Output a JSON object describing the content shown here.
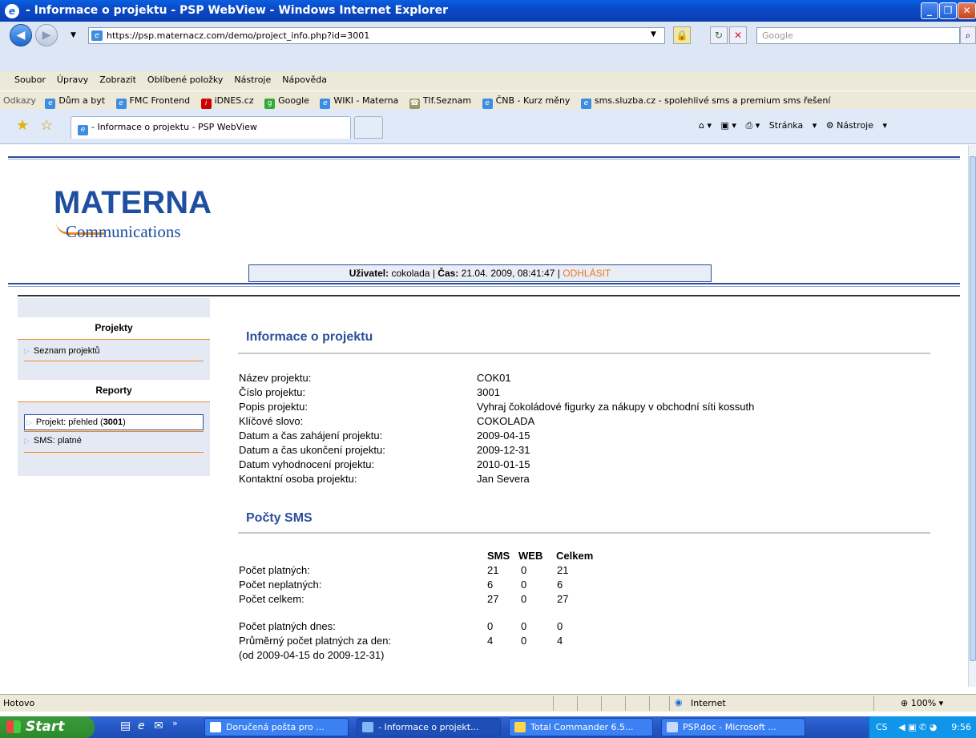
{
  "window": {
    "title": "- Informace o projektu - PSP WebView - Windows Internet Explorer"
  },
  "address": {
    "url": "https://psp.maternacz.com/demo/project_info.php?id=3001",
    "search_placeholder": "Google"
  },
  "menu": [
    "Soubor",
    "Úpravy",
    "Zobrazit",
    "Oblíbené položky",
    "Nástroje",
    "Nápověda"
  ],
  "links": {
    "label": "Odkazy",
    "items": [
      "Dům a byt",
      "FMC Frontend",
      "iDNES.cz",
      "Google",
      "WIKI - Materna",
      "Tlf.Seznam",
      "ČNB - Kurz měny",
      "sms.sluzba.cz - spolehlivé sms a premium sms řešení"
    ]
  },
  "tab": {
    "title": "- Informace o projektu - PSP WebView"
  },
  "toolbar_right": {
    "page": "Stránka",
    "tools": "Nástroje"
  },
  "logo": {
    "main": "MATERNA",
    "sub": "Communications"
  },
  "userbar": {
    "user_label": "Uživatel:",
    "user": "cokolada",
    "sep": "|",
    "time_label": "Čas:",
    "time": "21.04. 2009, 08:41:47",
    "sep2": "|",
    "logout": "ODHLÁSIT"
  },
  "sidebar": {
    "projects_header": "Projekty",
    "project_list": "Seznam projektů",
    "reports_header": "Reporty",
    "report_overview_prefix": "Projekt: přehled (",
    "report_overview_id": "3001",
    "report_overview_suffix": ")",
    "report_sms": "SMS: platné"
  },
  "info": {
    "title": "Informace o projektu",
    "rows": [
      {
        "label": "Název projektu:",
        "value": "COK01"
      },
      {
        "label": "Číslo projektu:",
        "value": "3001"
      },
      {
        "label": "Popis projektu:",
        "value": "Vyhraj čokoládové figurky za nákupy v obchodní síti kossuth"
      },
      {
        "label": "Klíčové slovo:",
        "value": "COKOLADA"
      },
      {
        "label": "Datum a čas zahájení projektu:",
        "value": "2009-04-15"
      },
      {
        "label": "Datum a čas ukončení projektu:",
        "value": "2009-12-31"
      },
      {
        "label": "Datum vyhodnocení projektu:",
        "value": "2010-01-15"
      },
      {
        "label": "Kontaktní osoba projektu:",
        "value": "Jan Severa"
      }
    ]
  },
  "sms": {
    "title": "Počty SMS",
    "headers": [
      "SMS",
      "WEB",
      "Celkem"
    ],
    "rows": [
      {
        "label": "Počet platných:",
        "sms": "21",
        "web": "0",
        "total": "21"
      },
      {
        "label": "Počet neplatných:",
        "sms": "6",
        "web": "0",
        "total": "6"
      },
      {
        "label": "Počet celkem:",
        "sms": "27",
        "web": "0",
        "total": "27"
      },
      {
        "label": "Počet platných dnes:",
        "sms": "0",
        "web": "0",
        "total": "0"
      },
      {
        "label": "Průměrný počet platných za den:",
        "sms": "4",
        "web": "0",
        "total": "4"
      }
    ],
    "range_note": "(od 2009-04-15 do 2009-12-31)"
  },
  "status": {
    "text": "Hotovo",
    "zone": "Internet",
    "zoom": "100%"
  },
  "taskbar": {
    "start": "Start",
    "buttons": [
      "Doručená pošta pro ...",
      "- Informace o projekt...",
      "Total Commander 6.5...",
      "PSP.doc - Microsoft ..."
    ],
    "lang": "CS",
    "clock": "9:56"
  }
}
